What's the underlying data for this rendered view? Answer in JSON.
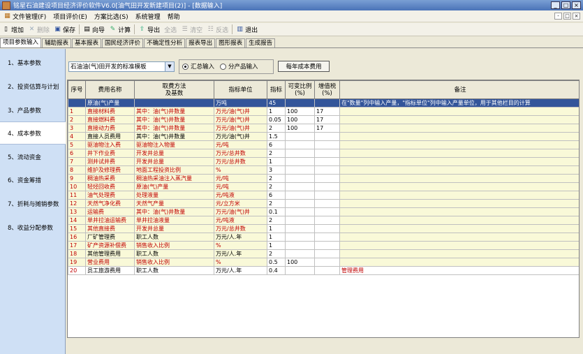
{
  "window": {
    "title": "铭星石油建设项目经济评价软件V6.0[油气田开发新建项目(2)] - [数据输入]",
    "buttons": [
      "_",
      "□",
      "×"
    ]
  },
  "menu": [
    {
      "label": "文件管理(F)",
      "icon": "app-menu-icon"
    },
    {
      "label": "项目评价(E)"
    },
    {
      "label": "方案比选(S)"
    },
    {
      "label": "系统管理"
    },
    {
      "label": "帮助"
    }
  ],
  "menu_right": [
    "-",
    "□",
    "×"
  ],
  "toolbar": {
    "add": "增加",
    "delete": "删除",
    "save": "保存",
    "wizard": "向导",
    "calc": "计算",
    "export": "导出",
    "select_all": "全选",
    "clear": "清空",
    "invert": "反选",
    "exit": "退出"
  },
  "tabs": [
    "项目参数输入",
    "辅助报表",
    "基本报表",
    "国民经济评价",
    "不确定性分析",
    "报表导出",
    "图形报表",
    "生成报告"
  ],
  "nav": [
    "1、基本参数",
    "2、投资估算与计划",
    "3、产品参数",
    "4、成本参数",
    "5、流动资金",
    "6、资金筹措",
    "7、折耗与摊销参数",
    "8、收益分配参数"
  ],
  "template": {
    "selected": "石油油(气)田开发的标准模板",
    "radio_sum": "汇总输入",
    "radio_product": "分产品输入",
    "radio_selected": "sum",
    "annual_cost_button": "每年成本费用"
  },
  "grid": {
    "headers": [
      "序号",
      "费用名称",
      "取费方法\n及基数",
      "指标单位",
      "指标",
      "可变比例\n(%)",
      "增值税\n(%)",
      "备注"
    ],
    "header_row": [
      "",
      "原油(气)产量",
      "",
      "万吨",
      "45",
      "",
      "",
      "在\"数量\"列中输入产量，\"指标单位\"列中输入产量单位，用于其他栏目的计算"
    ],
    "rows": [
      [
        "1",
        "直接材料费",
        "其中：油(气)井数量",
        "万元/油(气)井",
        "1",
        "100",
        "17",
        ""
      ],
      [
        "2",
        "直接燃料费",
        "其中：油(气)井数量",
        "万元/油(气)井",
        "0.05",
        "100",
        "17",
        ""
      ],
      [
        "3",
        "直接动力费",
        "其中：油(气)井数量",
        "万元/油(气)井",
        "2",
        "100",
        "17",
        ""
      ],
      [
        "4",
        "直接人员费用",
        "其中：油(气)井数量",
        "万元/油(气)井",
        "1.5",
        "",
        "",
        ""
      ],
      [
        "5",
        "驱油物注入费",
        "驱油物注入物量",
        "元/吨",
        "6",
        "",
        "",
        ""
      ],
      [
        "6",
        "井下作业费",
        "开发井总量",
        "万元/总井数",
        "2",
        "",
        "",
        ""
      ],
      [
        "7",
        "测井试井费",
        "开发井总量",
        "万元/总井数",
        "1",
        "",
        "",
        ""
      ],
      [
        "8",
        "维护及修理费",
        "地面工程投资比例",
        "%",
        "3",
        "",
        "",
        ""
      ],
      [
        "9",
        "稠油热采费",
        "稠油热采油注入蒸汽量",
        "元/吨",
        "2",
        "",
        "",
        ""
      ],
      [
        "10",
        "轻烃回收费",
        "原油(气)产量",
        "元/吨",
        "2",
        "",
        "",
        ""
      ],
      [
        "11",
        "油气处理费",
        "处理液量",
        "元/吨液",
        "6",
        "",
        "",
        ""
      ],
      [
        "12",
        "天然气净化费",
        "天然气产量",
        "元/立方米",
        "2",
        "",
        "",
        ""
      ],
      [
        "13",
        "运输费",
        "其中：油(气)井数量",
        "万元/油(气)井",
        "0.1",
        "",
        "",
        ""
      ],
      [
        "14",
        "单井拉油运输费",
        "单井拉油液量",
        "元/吨液",
        "2",
        "",
        "",
        ""
      ],
      [
        "15",
        "其他直接费",
        "开发井总量",
        "万元/总井数",
        "1",
        "",
        "",
        ""
      ],
      [
        "16",
        "厂矿管理费",
        "职工人数",
        "万元/人.年",
        "1",
        "",
        "",
        ""
      ],
      [
        "17",
        "矿产资源补偿费",
        "销售收入比例",
        "%",
        "1",
        "",
        "",
        ""
      ],
      [
        "18",
        "其他管理费用",
        "职工人数",
        "万元/人.年",
        "2",
        "",
        "",
        ""
      ],
      [
        "19",
        "营业费用",
        "销售收入比例",
        "%",
        "0.5",
        "100",
        "",
        ""
      ],
      [
        "20",
        "员工旅游费用",
        "职工人数",
        "万元/人.年",
        "0.4",
        "",
        "",
        "管理费用"
      ]
    ]
  }
}
